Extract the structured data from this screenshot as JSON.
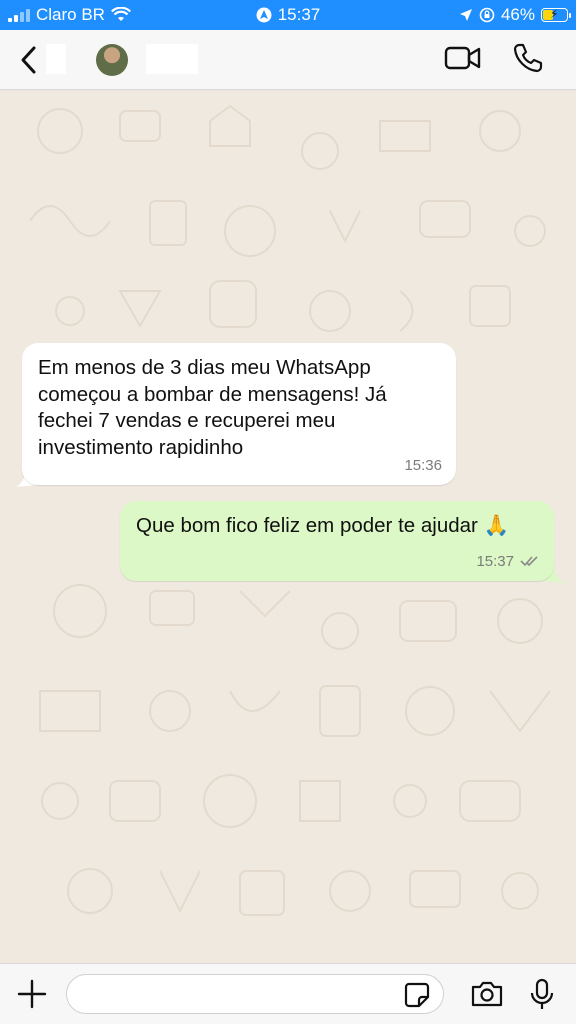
{
  "status_bar": {
    "carrier": "Claro BR",
    "time": "15:37",
    "battery_percent": "46%",
    "battery_level": 0.46,
    "color": "#1f8fff"
  },
  "header": {
    "icons": [
      "chevron-left-icon",
      "video-call-icon",
      "phone-icon"
    ]
  },
  "messages": [
    {
      "direction": "incoming",
      "text": "Em menos de 3 dias meu WhatsApp começou a bombar de mensagens! Já fechei 7 vendas e recuperei meu investimento rapidinho",
      "time": "15:36"
    },
    {
      "direction": "outgoing",
      "text": "Que bom fico feliz em poder te ajudar 🙏",
      "time": "15:37",
      "status": "read"
    }
  ],
  "input_bar": {
    "placeholder": "",
    "icons": [
      "plus-icon",
      "sticker-icon",
      "camera-icon",
      "microphone-icon"
    ]
  },
  "colors": {
    "incoming_bubble": "#ffffff",
    "outgoing_bubble": "#dcf8c6",
    "chat_background": "#efe9e0"
  }
}
